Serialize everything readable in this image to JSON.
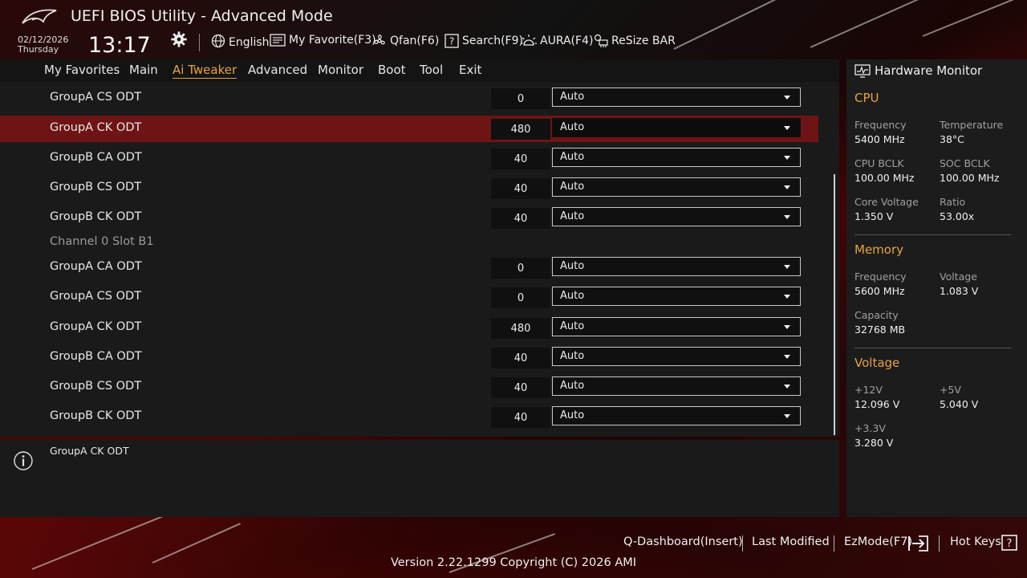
{
  "header": {
    "title": "UEFI BIOS Utility - Advanced Mode",
    "date": "02/12/2026",
    "day": "Thursday",
    "time": "13:17",
    "toolbar": [
      {
        "icon": "globe-icon",
        "label": "English"
      },
      {
        "icon": "favorite-icon",
        "label": "My Favorite(F3)"
      },
      {
        "icon": "fan-icon",
        "label": "Qfan(F6)"
      },
      {
        "icon": "search-icon",
        "label": "Search(F9)"
      },
      {
        "icon": "aura-icon",
        "label": "AURA(F4)"
      },
      {
        "icon": "resize-bar-icon",
        "label": "ReSize BAR"
      }
    ]
  },
  "menu": {
    "items": [
      "My Favorites",
      "Main",
      "Ai Tweaker",
      "Advanced",
      "Monitor",
      "Boot",
      "Tool",
      "Exit"
    ],
    "active": "Ai Tweaker"
  },
  "settings": {
    "rows_a": [
      {
        "label": "GroupA CS ODT",
        "value": "0",
        "option": "Auto"
      },
      {
        "label": "GroupA CK ODT",
        "value": "480",
        "option": "Auto"
      },
      {
        "label": "GroupB CA ODT",
        "value": "40",
        "option": "Auto"
      },
      {
        "label": "GroupB CS ODT",
        "value": "40",
        "option": "Auto"
      },
      {
        "label": "GroupB CK ODT",
        "value": "40",
        "option": "Auto"
      }
    ],
    "section_label": "Channel 0 Slot B1",
    "rows_b": [
      {
        "label": "GroupA CA ODT",
        "value": "0",
        "option": "Auto"
      },
      {
        "label": "GroupA CS ODT",
        "value": "0",
        "option": "Auto"
      },
      {
        "label": "GroupA CK ODT",
        "value": "480",
        "option": "Auto"
      },
      {
        "label": "GroupB CA ODT",
        "value": "40",
        "option": "Auto"
      },
      {
        "label": "GroupB CS ODT",
        "value": "40",
        "option": "Auto"
      },
      {
        "label": "GroupB CK ODT",
        "value": "40",
        "option": "Auto"
      }
    ]
  },
  "help": {
    "text": "GroupA CK ODT"
  },
  "hw_monitor": {
    "title": "Hardware Monitor",
    "cpu": {
      "heading": "CPU",
      "frequency_label": "Frequency",
      "frequency": "5400 MHz",
      "temperature_label": "Temperature",
      "temperature": "38°C",
      "cpu_bclk_label": "CPU BCLK",
      "cpu_bclk": "100.00 MHz",
      "soc_bclk_label": "SOC BCLK",
      "soc_bclk": "100.00 MHz",
      "core_voltage_label": "Core Voltage",
      "core_voltage": "1.350 V",
      "ratio_label": "Ratio",
      "ratio": "53.00x"
    },
    "memory": {
      "heading": "Memory",
      "frequency_label": "Frequency",
      "frequency": "5600 MHz",
      "voltage_label": "Voltage",
      "voltage": "1.083 V",
      "capacity_label": "Capacity",
      "capacity": "32768 MB"
    },
    "voltage": {
      "heading": "Voltage",
      "v12_label": "+12V",
      "v12": "12.096 V",
      "v5_label": "+5V",
      "v5": "5.040 V",
      "v33_label": "+3.3V",
      "v33": "3.280 V"
    }
  },
  "footer": {
    "q_dashboard": "Q-Dashboard(Insert)",
    "last_modified": "Last Modified",
    "ez_mode": "EzMode(F7)",
    "hot_keys": "Hot Keys",
    "version": "Version 2.22.1299 Copyright (C) 2026 AMI"
  },
  "colors": {
    "accent": "#e8a33d",
    "selected_row": "#6e1414"
  }
}
